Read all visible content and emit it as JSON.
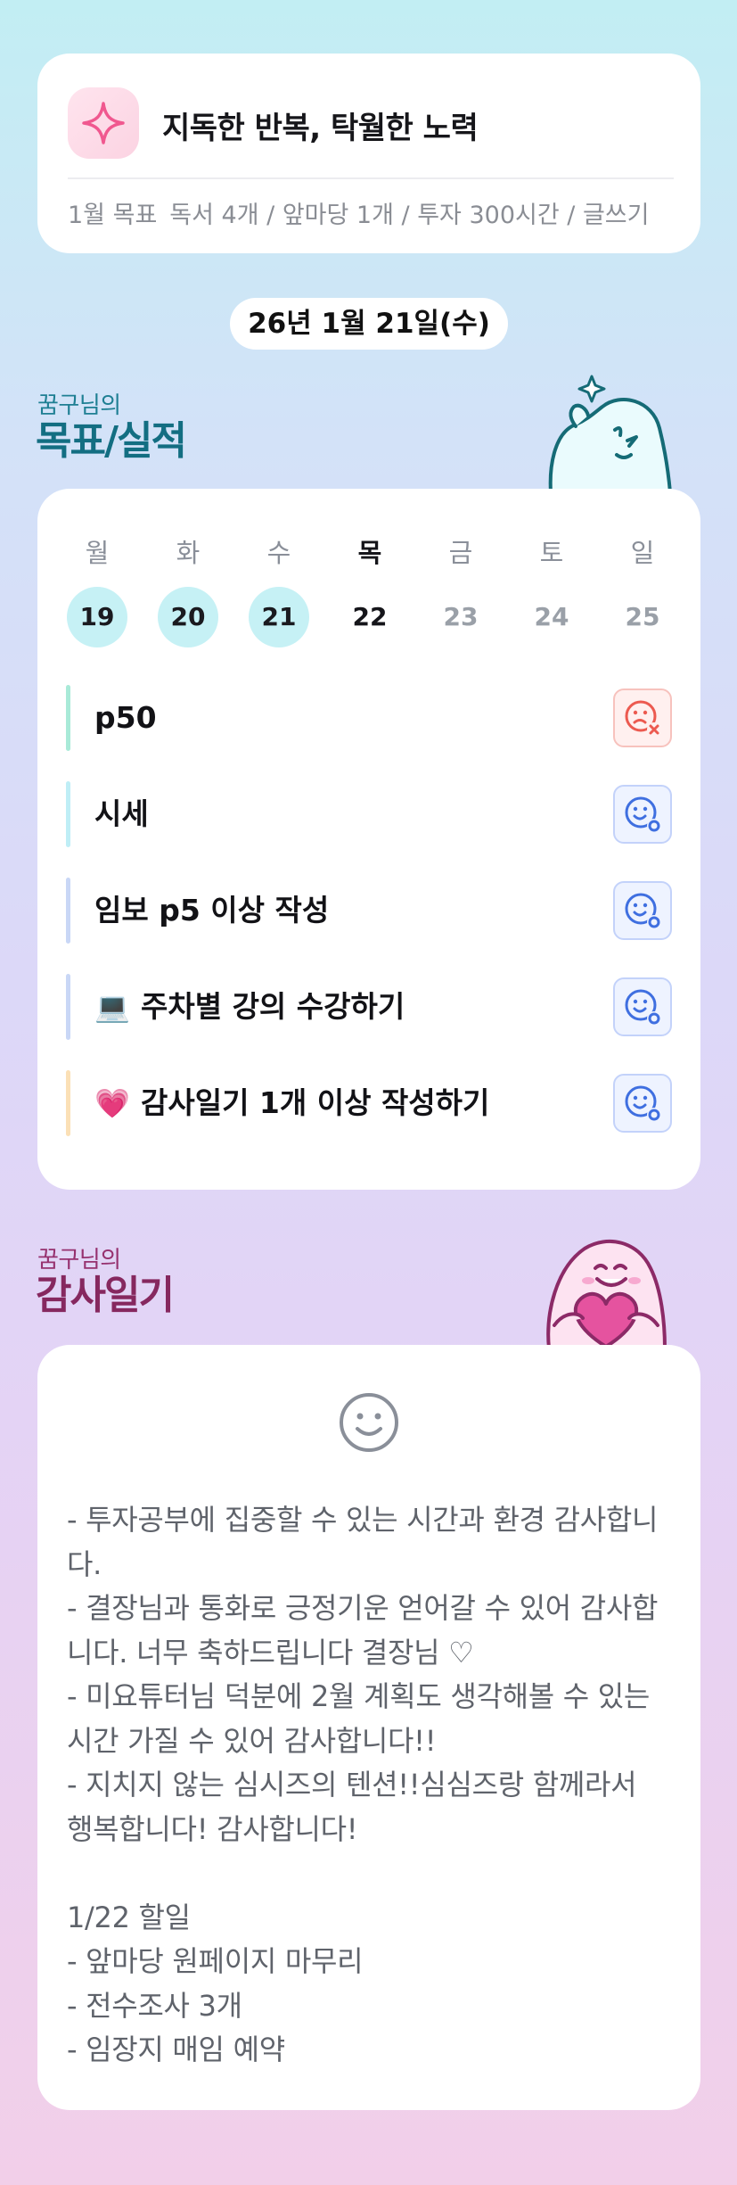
{
  "header": {
    "title": "지독한 반복, 탁월한 노력",
    "goal_label": "1월 목표",
    "goal_text": "독서 4개 / 앞마당 1개 / 투자 300시간 / 글쓰기"
  },
  "date": "26년 1월 21일(수)",
  "goals_section": {
    "owner": "꿈구님의",
    "title": "목표/실적"
  },
  "week": {
    "days": [
      {
        "label": "월",
        "num": "19",
        "state": "done"
      },
      {
        "label": "화",
        "num": "20",
        "state": "done"
      },
      {
        "label": "수",
        "num": "21",
        "state": "done"
      },
      {
        "label": "목",
        "num": "22",
        "state": "today"
      },
      {
        "label": "금",
        "num": "23",
        "state": "future"
      },
      {
        "label": "토",
        "num": "24",
        "state": "future"
      },
      {
        "label": "일",
        "num": "25",
        "state": "future"
      }
    ]
  },
  "tasks": [
    {
      "emoji": "",
      "text": "p50",
      "bar_color": "#a9ead8",
      "status": "fail",
      "status_icon": "sad-face-x-icon"
    },
    {
      "emoji": "",
      "text": "시세",
      "bar_color": "#bfeef6",
      "status": "ok",
      "status_icon": "smile-face-check-icon"
    },
    {
      "emoji": "",
      "text": "임보 p5 이상 작성",
      "bar_color": "#c9d7f6",
      "status": "ok",
      "status_icon": "smile-face-check-icon"
    },
    {
      "emoji": "💻",
      "text": "주차별 강의 수강하기",
      "bar_color": "#c9d7f6",
      "status": "ok",
      "status_icon": "smile-face-check-icon"
    },
    {
      "emoji": "💗",
      "text": "감사일기 1개 이상 작성하기",
      "bar_color": "#fbe0b6",
      "status": "ok",
      "status_icon": "smile-face-check-icon"
    }
  ],
  "diary_section": {
    "owner": "꿈구님의",
    "title": "감사일기"
  },
  "diary": {
    "mood_icon": "smiley-face-icon",
    "text": "- 투자공부에 집중할 수 있는 시간과 환경 감사합니다.\n- 결장님과 통화로 긍정기운 얻어갈 수 있어 감사합니다. 너무 축하드립니다 결장님 ♡\n- 미요튜터님 덕분에 2월 계획도 생각해볼 수 있는 시간 가질 수 있어 감사합니다!!\n- 지치지 않는 심시즈의 텐션!!심심즈랑 함께라서 행복합니다! 감사합니다!\n\n1/22 할일\n- 앞마당 원페이지 마무리\n- 전수조사 3개\n- 임장지 매임 예약"
  },
  "colors": {
    "accent_teal": "#136e82",
    "accent_plum": "#86285f",
    "fail_red": "#ec5a50",
    "ok_blue": "#3f6fe0"
  }
}
